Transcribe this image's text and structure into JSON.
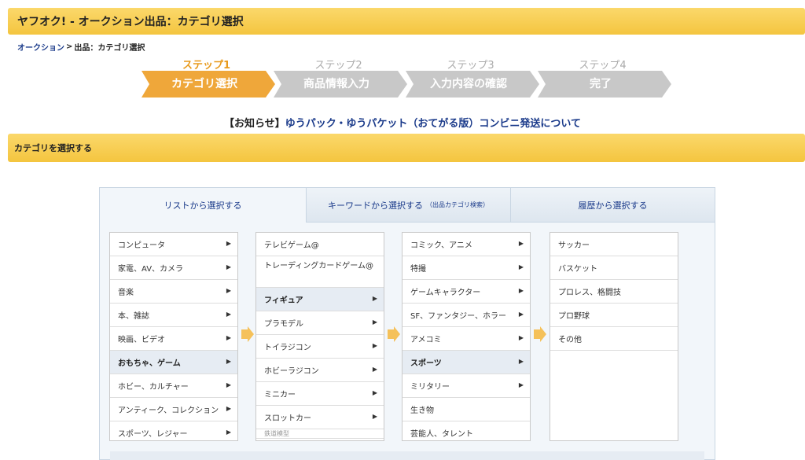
{
  "header": {
    "title": "ヤフオク! - オークション出品：カテゴリ選択"
  },
  "breadcrumb": {
    "link": "オークション",
    "sep": " > ",
    "current": "出品：カテゴリ選択"
  },
  "steps": [
    {
      "label": "ステップ1",
      "name": "カテゴリ選択",
      "active": true
    },
    {
      "label": "ステップ2",
      "name": "商品情報入力",
      "active": false
    },
    {
      "label": "ステップ3",
      "name": "入力内容の確認",
      "active": false
    },
    {
      "label": "ステップ4",
      "name": "完了",
      "active": false
    }
  ],
  "notice": {
    "prefix": "【お知らせ】",
    "link": "ゆうパック・ゆうパケット（おてがる版）コンビニ発送について"
  },
  "section": {
    "title": "カテゴリを選択する"
  },
  "tabs": [
    {
      "label": "リストから選択する",
      "sub": ""
    },
    {
      "label": "キーワードから選択する",
      "sub": "（出品カテゴリ検索）"
    },
    {
      "label": "履歴から選択する",
      "sub": ""
    }
  ],
  "columns": {
    "col1": [
      "コンピュータ",
      "家電、AV、カメラ",
      "音楽",
      "本、雑誌",
      "映画、ビデオ",
      "おもちゃ、ゲーム",
      "ホビー、カルチャー",
      "アンティーク、コレクション",
      "スポーツ、レジャー"
    ],
    "col2": [
      "テレビゲーム@",
      "トレーディングカードゲーム@",
      "フィギュア",
      "プラモデル",
      "トイラジコン",
      "ホビーラジコン",
      "ミニカー",
      "スロットカー",
      "鉄道模型"
    ],
    "col3": [
      "コミック、アニメ",
      "特撮",
      "ゲームキャラクター",
      "SF、ファンタジー、ホラー",
      "アメコミ",
      "スポーツ",
      "ミリタリー",
      "生き物",
      "芸能人、タレント"
    ],
    "col4": [
      "サッカー",
      "バスケット",
      "プロレス、格闘技",
      "プロ野球",
      "その他"
    ]
  },
  "colors": {
    "accent": "#f4c53f",
    "step_active": "#e89a1c",
    "link": "#1a3a8a",
    "chevron": "#f5c15a"
  }
}
